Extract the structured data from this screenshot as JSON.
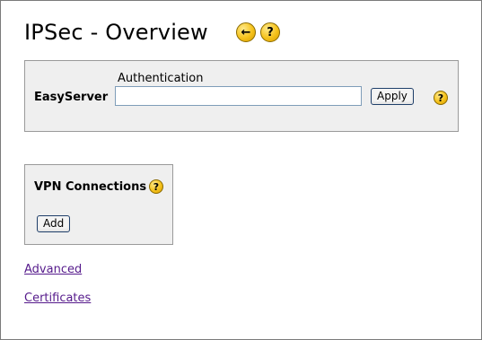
{
  "page": {
    "title": "IPSec - Overview"
  },
  "icons": {
    "back": "arrow-left-icon",
    "help": "question-mark-icon",
    "back_glyph": "←",
    "help_glyph": "?"
  },
  "easyserver": {
    "label": "EasyServer",
    "auth_label": "Authentication",
    "auth_value": "",
    "apply_label": "Apply"
  },
  "vpn": {
    "title": "VPN Connections",
    "add_label": "Add"
  },
  "links": {
    "advanced": "Advanced",
    "certificates": "Certificates"
  },
  "colors": {
    "panel_bg": "#efefef",
    "icon_yellow": "#f5c21b",
    "link_visited": "#551a8b"
  }
}
